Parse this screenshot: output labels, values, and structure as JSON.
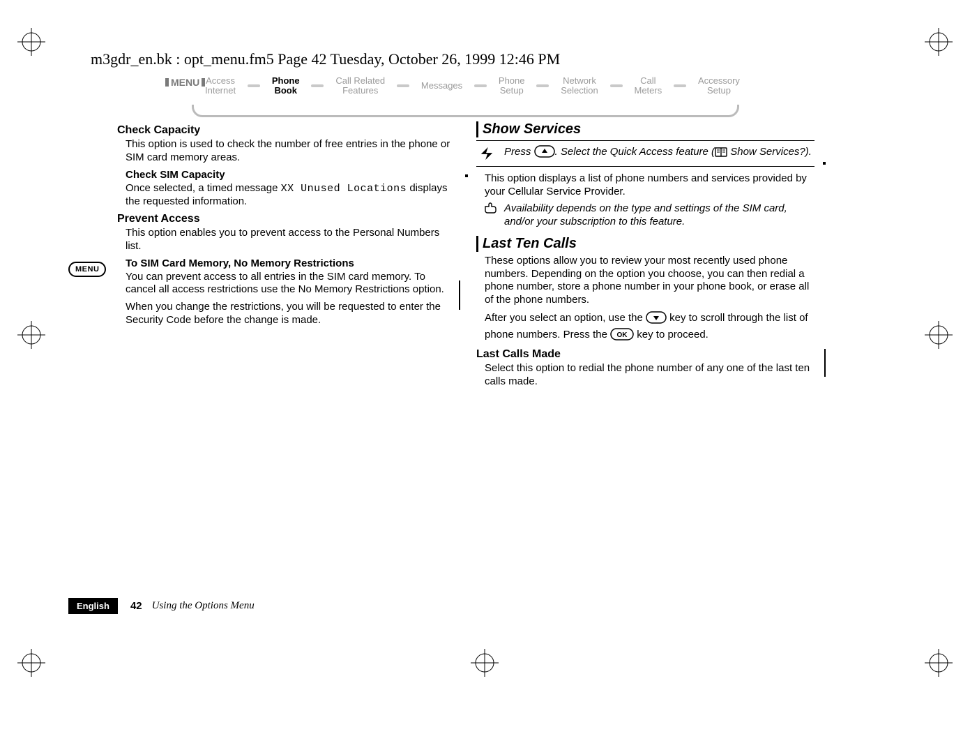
{
  "header_line": "m3gdr_en.bk : opt_menu.fm5  Page 42  Tuesday, October 26, 1999  12:46 PM",
  "nav": {
    "menu_label": "MENU",
    "items": [
      {
        "l1": "Access",
        "l2": "Internet",
        "active": false
      },
      {
        "l1": "Phone",
        "l2": "Book",
        "active": true
      },
      {
        "l1": "Call Related",
        "l2": "Features",
        "active": false
      },
      {
        "l1": "Messages",
        "l2": "",
        "active": false
      },
      {
        "l1": "Phone",
        "l2": "Setup",
        "active": false
      },
      {
        "l1": "Network",
        "l2": "Selection",
        "active": false
      },
      {
        "l1": "Call",
        "l2": "Meters",
        "active": false
      },
      {
        "l1": "Accessory",
        "l2": "Setup",
        "active": false
      }
    ]
  },
  "left": {
    "check_capacity": {
      "title": "Check Capacity",
      "body": "This option is used to check the number of free entries in the phone or SIM card memory areas."
    },
    "check_sim": {
      "title": "Check SIM Capacity",
      "body_pre": "Once selected, a timed message ",
      "body_mono": "XX Unused Locations",
      "body_post": " displays the requested information."
    },
    "prevent": {
      "title": "Prevent Access",
      "body": "This option enables you to prevent access to the Personal Numbers list."
    },
    "tosim": {
      "title": "To SIM Card Memory, No Memory Restrictions",
      "body1": "You can prevent access to all entries in the SIM card memory. To cancel all access restrictions use the No Memory Restrictions option.",
      "body2": "When you change the restrictions, you will be requested to enter the Security Code before the change is made."
    }
  },
  "right": {
    "show_services": {
      "title": "Show Services",
      "quick_pre": "Press ",
      "quick_mid": ". Select the Quick Access feature (",
      "quick_post": " Show Services?).",
      "body": "This option displays a list of phone numbers and services provided by your Cellular Service Provider.",
      "note": "Availability depends on the type and settings of the SIM card, and/or your subscription to this feature."
    },
    "last_ten": {
      "title": "Last Ten Calls",
      "body1": "These options allow you to review your most recently used phone numbers. Depending on the option you choose, you can then redial a phone number, store a phone number in your phone book, or erase all of the phone numbers.",
      "body2_pre": "After you select an option, use the ",
      "body2_mid": " key to scroll through the list of phone numbers. Press the ",
      "body2_post": " key to proceed."
    },
    "last_made": {
      "title": "Last Calls Made",
      "body": "Select this option to redial the phone number of any one of the last ten calls made."
    }
  },
  "side_badge": "MENU",
  "footer": {
    "lang": "English",
    "page_no": "42",
    "section": "Using the Options Menu"
  },
  "icons": {
    "up_key": "↑",
    "down_key": "↓",
    "ok_key": "OK",
    "book": "book-icon",
    "hand": "hand-icon",
    "lightning": "lightning-icon"
  }
}
